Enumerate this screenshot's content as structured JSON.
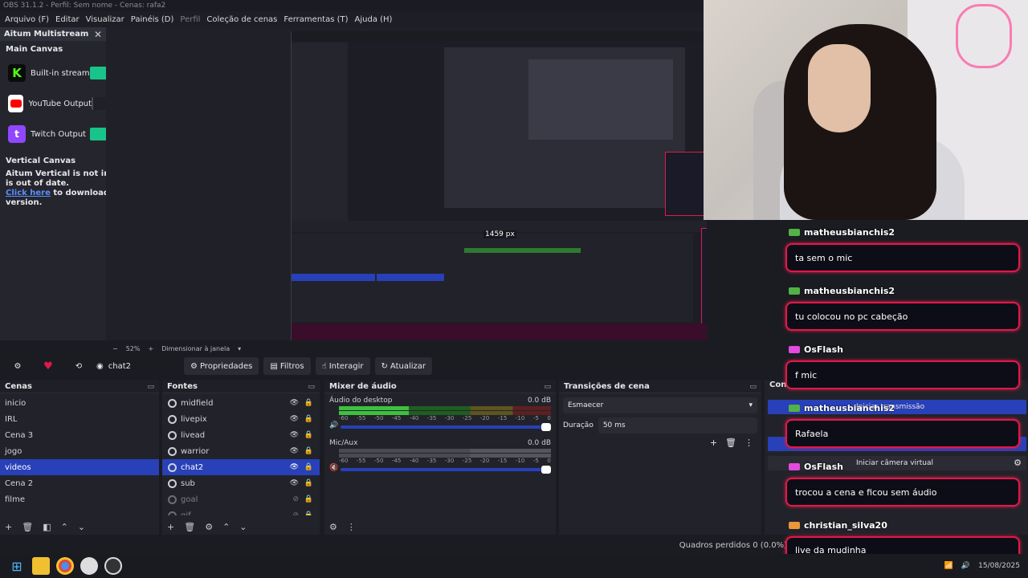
{
  "window": {
    "title": "OBS 31.1.2 - Perfil: Sem nome - Cenas: rafa2"
  },
  "menu": [
    {
      "label": "Arquivo (F)",
      "dim": false
    },
    {
      "label": "Editar",
      "dim": false
    },
    {
      "label": "Visualizar",
      "dim": false
    },
    {
      "label": "Painéis (D)",
      "dim": false
    },
    {
      "label": "Perfil",
      "dim": true
    },
    {
      "label": "Coleção de cenas",
      "dim": false
    },
    {
      "label": "Ferramentas (T)",
      "dim": false
    },
    {
      "label": "Ajuda (H)",
      "dim": false
    }
  ],
  "multistream": {
    "title": "Aitum Multistream",
    "main_canvas": "Main Canvas",
    "outputs": [
      {
        "label": "Built-in stream",
        "icon": "kick-icon",
        "on": true
      },
      {
        "label": "YouTube Output",
        "icon": "youtube-icon",
        "on": false
      },
      {
        "label": "Twitch Output",
        "icon": "twitch-icon",
        "on": true
      }
    ],
    "vertical_canvas": "Vertical Canvas",
    "vertical_msg_1": "Aitum Vertical is not installe",
    "vertical_msg_2": "is out of date.",
    "click_here": "Click here",
    "vertical_msg_3": " to download the la",
    "vertical_msg_4": "version."
  },
  "preview": {
    "px_label": "1459 px",
    "zoom": "52%",
    "resize_label": "Dimensionar à janela"
  },
  "toolbar": {
    "scene_name": "chat2",
    "properties": "Propriedades",
    "filters": "Filtros",
    "interact": "Interagir",
    "refresh": "Atualizar"
  },
  "scenes": {
    "title": "Cenas",
    "items": [
      "inicio",
      "IRL",
      "Cena 3",
      "jogo",
      "videos",
      "Cena 2",
      "filme"
    ],
    "selected": 4
  },
  "sources": {
    "title": "Fontes",
    "items": [
      {
        "label": "midfield",
        "visible": true
      },
      {
        "label": "livepix",
        "visible": true
      },
      {
        "label": "livead",
        "visible": true
      },
      {
        "label": "warrior",
        "visible": true
      },
      {
        "label": "chat2",
        "visible": true
      },
      {
        "label": "sub",
        "visible": true
      },
      {
        "label": "goal",
        "visible": false
      },
      {
        "label": "gif",
        "visible": false
      }
    ],
    "selected": 4
  },
  "mixer": {
    "title": "Mixer de áudio",
    "tracks": [
      {
        "name": "Áudio do desktop",
        "db": "0.0 dB",
        "level": 0.33
      },
      {
        "name": "Mic/Aux",
        "db": "0.0 dB",
        "level": 0
      }
    ],
    "scale": [
      "-60",
      "-55",
      "-50",
      "-45",
      "-40",
      "-35",
      "-30",
      "-25",
      "-20",
      "-15",
      "-10",
      "-5",
      "0"
    ]
  },
  "transitions": {
    "title": "Transições de cena",
    "selected": "Esmaecer",
    "duration_label": "Duração",
    "duration_value": "50 ms"
  },
  "controls": {
    "title": "Contro",
    "start_stream": "Iniciar transmissão",
    "virtual_cam": "Iniciar câmera virtual"
  },
  "status": {
    "dropped_frames": "Quadros perdidos 0 (0.0%)"
  },
  "taskbar": {
    "date": "15/08/2025"
  },
  "chat": [
    {
      "user": "matheusbianchis2",
      "badge": "green",
      "msg": "ta sem o mic"
    },
    {
      "user": "matheusbianchis2",
      "badge": "green",
      "msg": "tu colocou no pc cabeção"
    },
    {
      "user": "OsFlash",
      "badge": "pink",
      "msg": "f mic"
    },
    {
      "user": "matheusbianchis2",
      "badge": "green",
      "msg": "Rafaela"
    },
    {
      "user": "OsFlash",
      "badge": "pink",
      "msg": "trocou a cena e ficou sem áudio"
    },
    {
      "user": "christian_silva20",
      "badge": "orange",
      "msg": "live da mudinha"
    }
  ]
}
